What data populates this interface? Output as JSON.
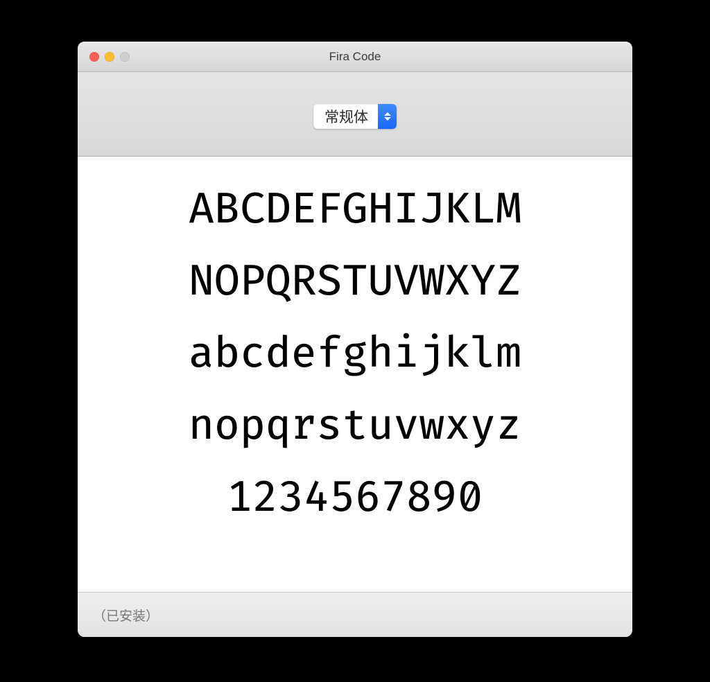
{
  "window": {
    "title": "Fira Code"
  },
  "toolbar": {
    "style_select": {
      "selected_label": "常规体"
    }
  },
  "preview": {
    "lines": [
      "ABCDEFGHIJKLM",
      "NOPQRSTUVWXYZ",
      "abcdefghijklm",
      "nopqrstuvwxyz",
      "1234567890"
    ]
  },
  "statusbar": {
    "status_text": "（已安装）"
  }
}
